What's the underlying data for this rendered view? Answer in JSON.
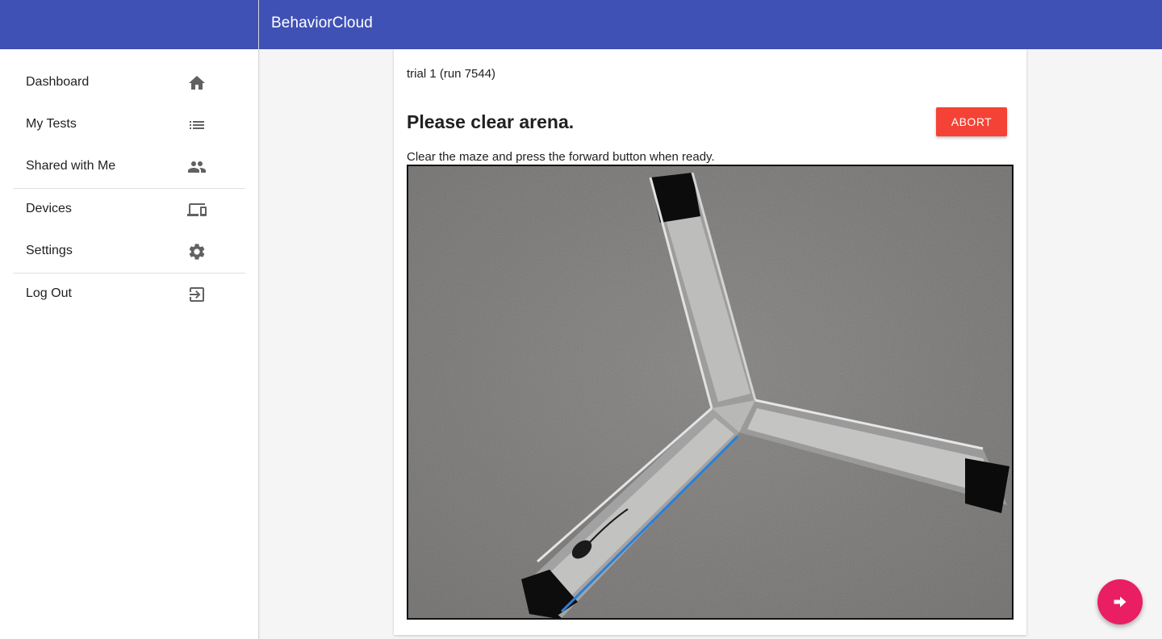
{
  "app": {
    "title": "BehaviorCloud",
    "brand_color": "#3f51b5"
  },
  "sidebar": {
    "items": [
      {
        "label": "Dashboard",
        "icon": "home-icon"
      },
      {
        "label": "My Tests",
        "icon": "list-icon"
      },
      {
        "label": "Shared with Me",
        "icon": "people-icon"
      },
      {
        "label": "Devices",
        "icon": "devices-icon"
      },
      {
        "label": "Settings",
        "icon": "gear-icon"
      },
      {
        "label": "Log Out",
        "icon": "exit-icon"
      }
    ]
  },
  "main": {
    "trial_label": "trial 1 (run 7544)",
    "prompt_title": "Please clear arena.",
    "abort_label": "ABORT",
    "abort_color": "#f44336",
    "instructions": "Clear the maze and press the forward button when ready.",
    "arena_image": "y-maze-camera-view"
  },
  "fab": {
    "icon": "forward-arrow-icon",
    "color": "#e91e63"
  }
}
